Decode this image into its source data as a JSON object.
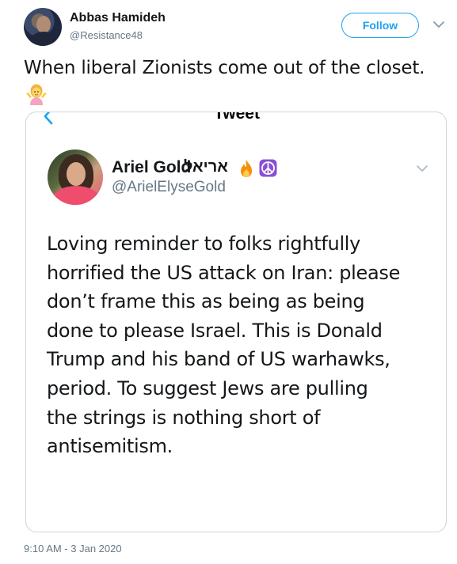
{
  "author": {
    "name": "Abbas Hamideh",
    "handle": "@Resistance48",
    "follow_label": "Follow"
  },
  "tweet": {
    "text": "When liberal Zionists come out of the closet.",
    "emoji": "person-shrugging-emoji",
    "timestamp": "9:10 AM - 3 Jan 2020"
  },
  "embedded_screenshot": {
    "title": "Tweet",
    "author_name": "Ariel Gold",
    "author_name_hebrew": "אריאל",
    "badges": [
      "fire-emoji",
      "peace-symbol-emoji"
    ],
    "author_handle": "@ArielElyseGold",
    "body_lines": [
      "Loving reminder to folks rightfully",
      "horrified the US attack on Iran: please",
      "don’t frame this as being as being",
      "done to please Israel. This is Donald",
      "Trump and his band of US warhawks,",
      "period. To suggest Jews are pulling",
      "the strings is nothing short of",
      "antisemitism."
    ]
  },
  "colors": {
    "accent": "#1da1f2",
    "secondary_text": "#657786",
    "border": "#ccd6dd"
  }
}
